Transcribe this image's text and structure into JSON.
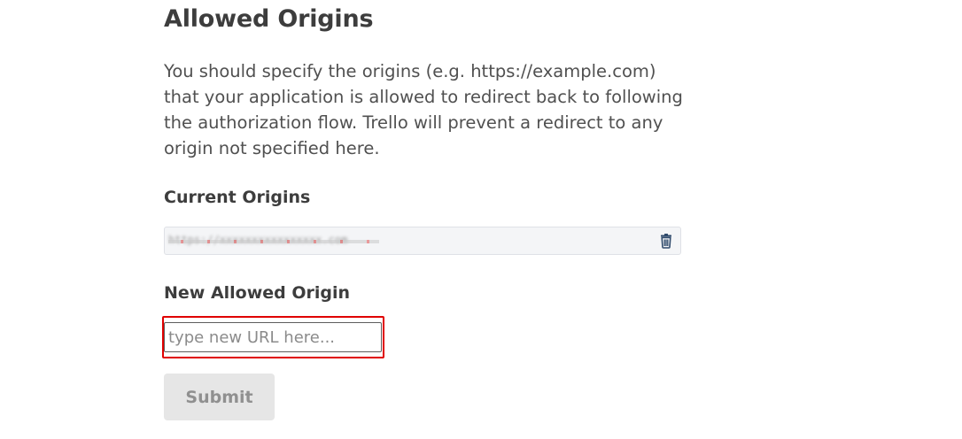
{
  "page": {
    "title": "Allowed Origins",
    "description_lines": [
      "You should specify the origins (e.g. https://example.com)",
      "that your application is allowed to redirect back to following",
      "the authorization flow. Trello will prevent a redirect to any",
      "origin not specified here."
    ]
  },
  "current_origins": {
    "heading": "Current Origins",
    "items": [
      {
        "value": "https://xxxxxxxxxxxxxxxx.com",
        "delete_icon": "trash-icon"
      }
    ]
  },
  "new_origin": {
    "heading": "New Allowed Origin",
    "input_value": "",
    "placeholder": "type new URL here..."
  },
  "submit": {
    "label": "Submit"
  },
  "colors": {
    "highlight": "#e00000",
    "heading": "#3d3d3d",
    "body_text": "#505050",
    "button_bg": "#e6e6e6"
  }
}
